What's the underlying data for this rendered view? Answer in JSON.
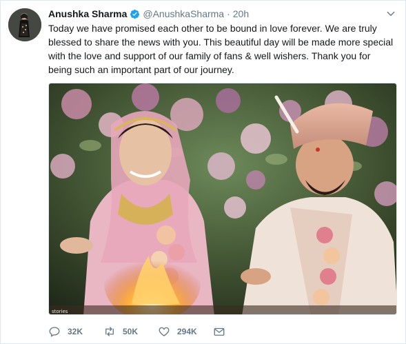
{
  "tweet": {
    "author_name": "Anushka Sharma",
    "handle": "@AnushkaSharma",
    "separator": "·",
    "time": "20h",
    "text": "Today we have promised each other to be bound in love forever. We are truly blessed to share the news with you. This beautiful day will be made more special with the love and support of our family of fans & well wishers. Thank you for being such an important part of our journey.",
    "media_watermark": "stories",
    "actions": {
      "replies": "32K",
      "retweets": "50K",
      "likes": "294K"
    }
  },
  "icons": {
    "verified": "verified-badge-icon",
    "caret": "chevron-down-icon",
    "reply": "reply-icon",
    "retweet": "retweet-icon",
    "like": "heart-icon",
    "message": "envelope-icon"
  },
  "colors": {
    "verified": "#1da1f2",
    "meta_text": "#657786",
    "body_text": "#14171a",
    "border": "#e1e8ed"
  }
}
